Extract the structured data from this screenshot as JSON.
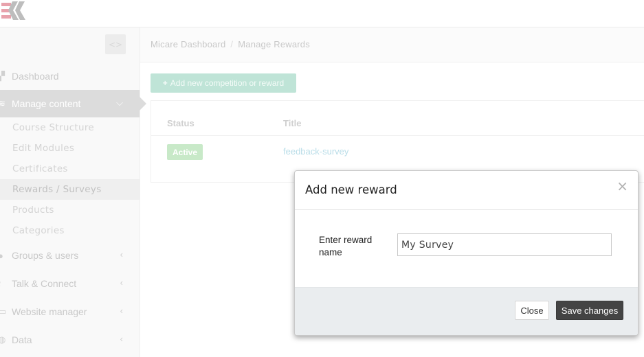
{
  "header": {
    "logo": "EK"
  },
  "sidebar": {
    "items": [
      {
        "label": "Dashboard",
        "icon": "dashboard-icon"
      },
      {
        "label": "Manage content",
        "icon": "layers-icon"
      },
      {
        "label": "Groups & users",
        "icon": "user-icon"
      },
      {
        "label": "Talk & Connect",
        "icon": "wifi-icon"
      },
      {
        "label": "Website manager",
        "icon": "laptop-icon"
      },
      {
        "label": "Data",
        "icon": "database-icon"
      }
    ],
    "subitems": [
      "Course Structure",
      "Edit Modules",
      "Certificates",
      "Rewards / Surveys",
      "Products",
      "Categories"
    ]
  },
  "breadcrumb": {
    "root": "Micare Dashboard",
    "current": "Manage Rewards",
    "separator": "/"
  },
  "toolbar": {
    "add_label": "Add new competition or reward"
  },
  "table": {
    "headers": [
      "Status",
      "Title"
    ],
    "rows": [
      {
        "status": "Active",
        "title": "feedback-survey"
      }
    ]
  },
  "modal": {
    "title": "Add new reward",
    "close_symbol": "×",
    "field_label": "Enter reward name",
    "field_value": "My Survey",
    "close_label": "Close",
    "save_label": "Save changes"
  },
  "colors": {
    "accent_green": "#bfe4d7",
    "status_active": "#c8e9c8",
    "link": "#b9dde8",
    "save_button": "#444444",
    "logo_pink": "#e8a2ac",
    "logo_grey": "#bdbdbd"
  }
}
